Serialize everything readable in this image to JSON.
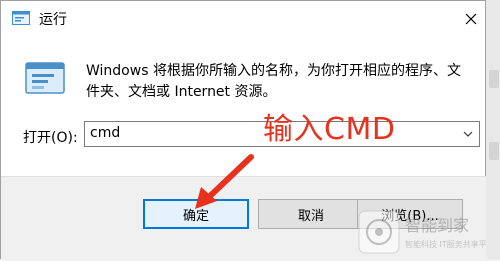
{
  "window": {
    "title": "运行",
    "description": "Windows 将根据你所输入的名称，为你打开相应的程序、文件夹、文档或 Internet 资源。",
    "open_label": "打开(O):",
    "command_value": "cmd"
  },
  "annotation": {
    "text": "输入CMD",
    "color": "#e8321e"
  },
  "buttons": {
    "ok": "确定",
    "cancel": "取消",
    "browse": "浏览(B)..."
  },
  "watermark": {
    "line1": "智能到家",
    "line2": "智能科技 IT服务共享平台"
  },
  "icons": {
    "app": "run-icon",
    "close": "close-icon",
    "dropdown": "chevron-down-icon",
    "pointer": "red-arrow-icon"
  },
  "colors": {
    "accent": "#0078d7",
    "annotation": "#e8321e"
  }
}
